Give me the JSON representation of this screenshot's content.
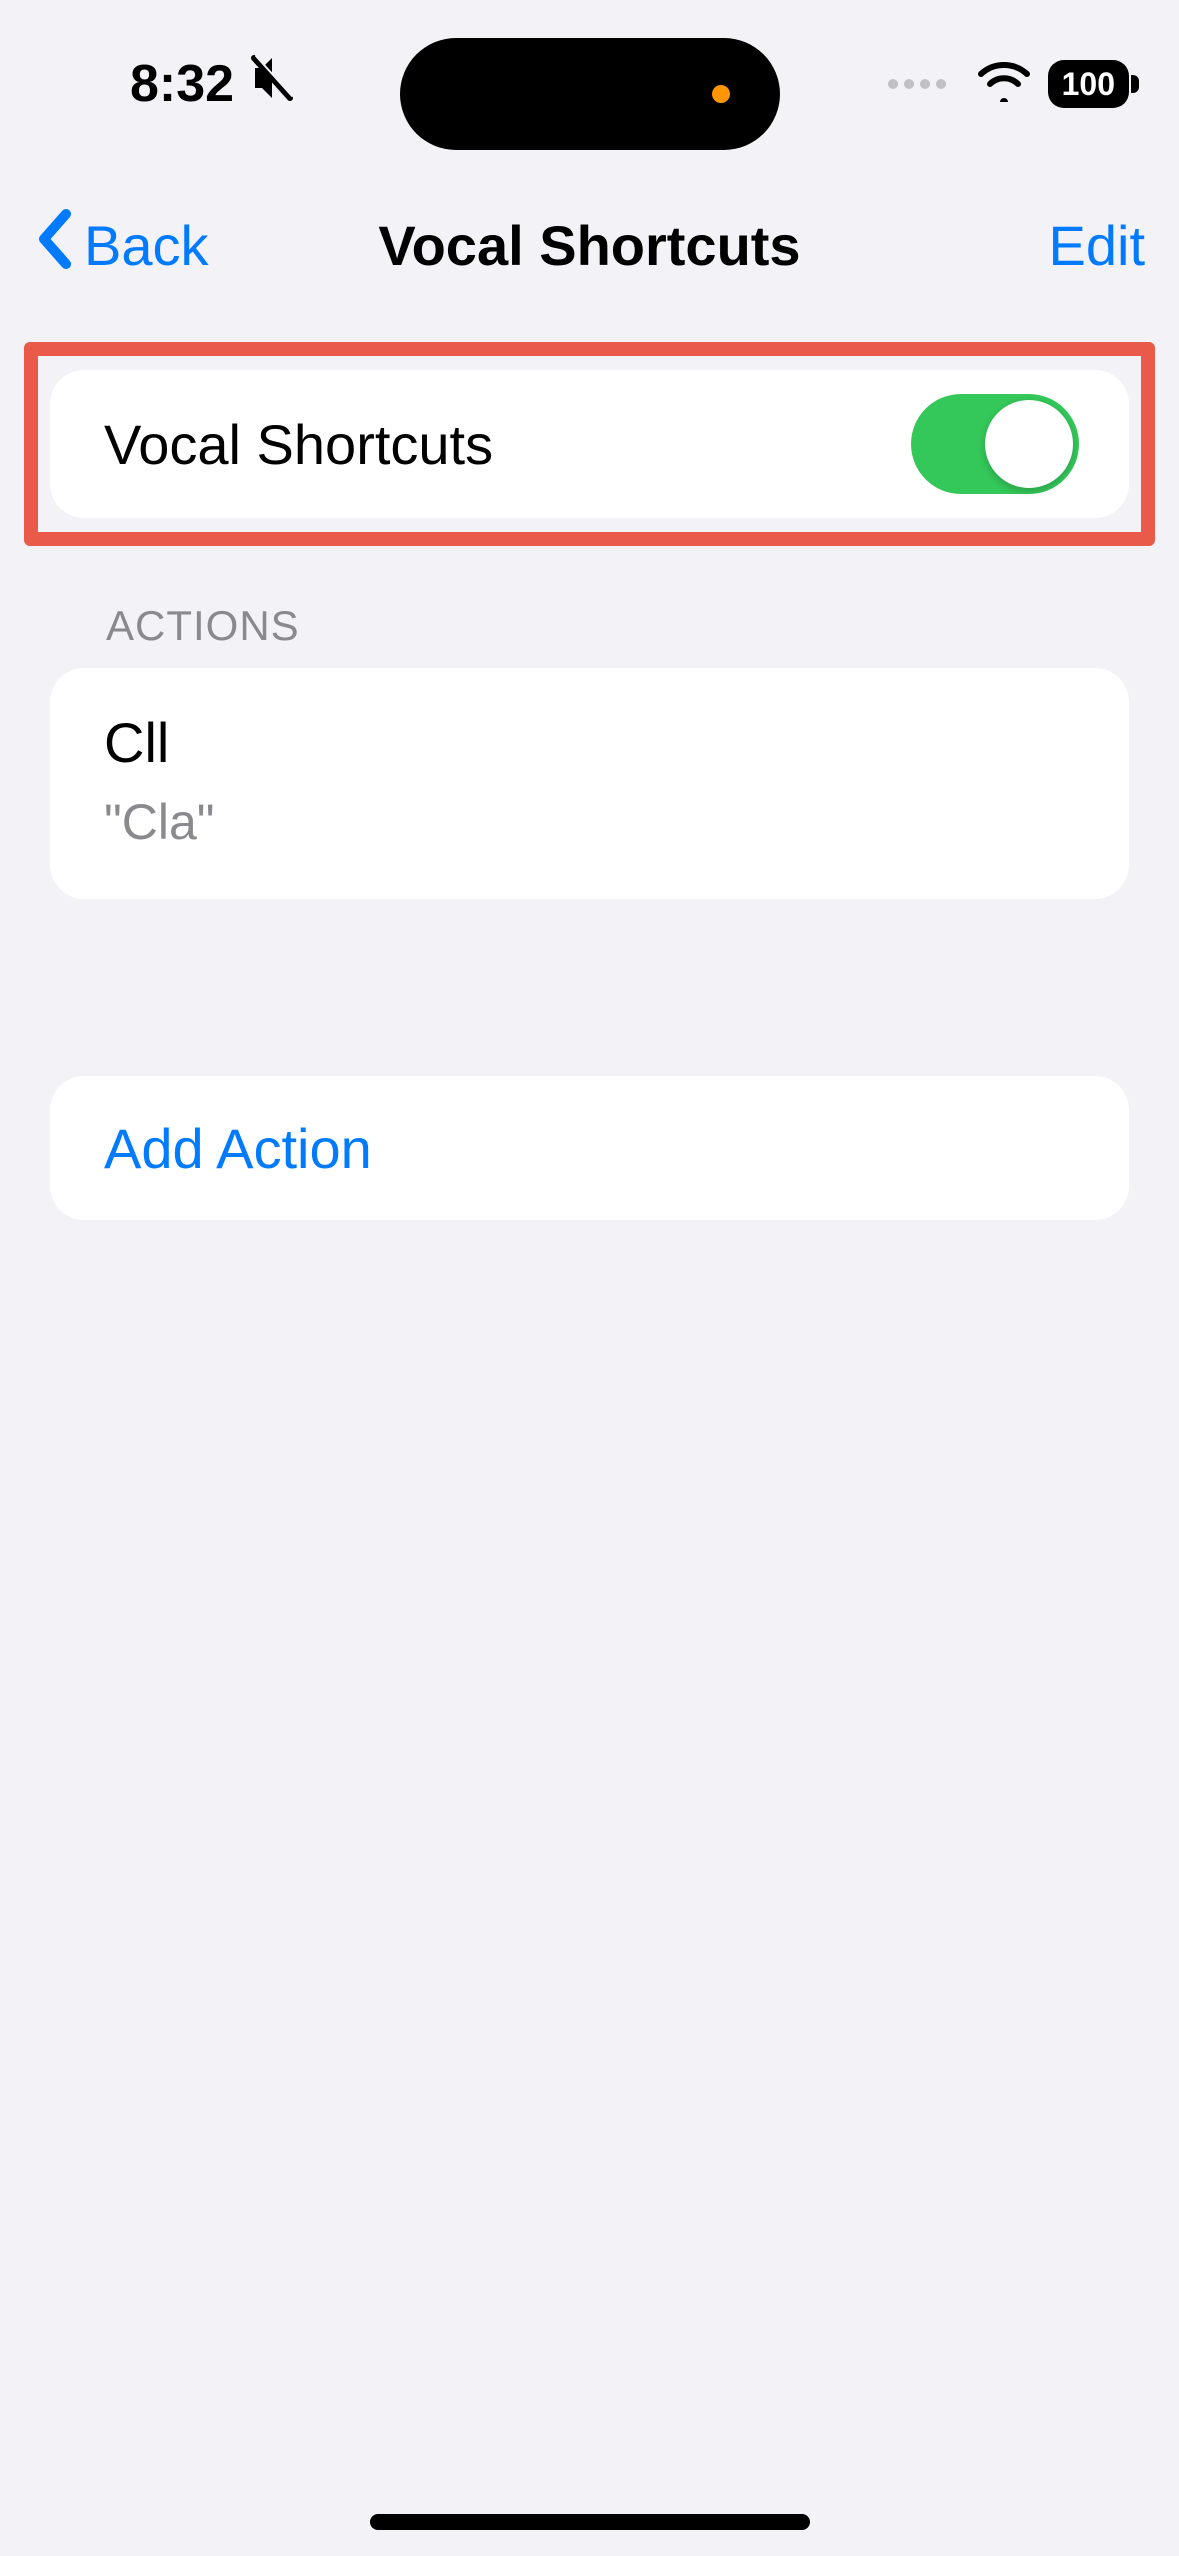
{
  "status": {
    "time": "8:32",
    "battery": "100"
  },
  "nav": {
    "back_label": "Back",
    "title": "Vocal Shortcuts",
    "edit_label": "Edit"
  },
  "main_toggle": {
    "label": "Vocal Shortcuts",
    "enabled": true
  },
  "actions": {
    "header": "ACTIONS",
    "items": [
      {
        "title": "Cll",
        "subtitle": "\"Cla\""
      }
    ]
  },
  "add_action": {
    "label": "Add Action"
  }
}
